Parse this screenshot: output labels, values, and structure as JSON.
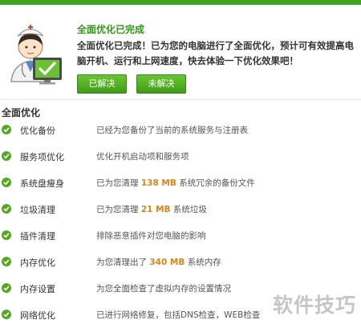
{
  "header": {
    "title": "全面优化已完成",
    "description": "全面优化已完成！已为您的电脑进行了全面优化，预计可有效提高电脑开机、运行和上网速度，快去体验一下优化效果吧！",
    "resolved_label": "已解决",
    "unresolved_label": "未解决"
  },
  "section": {
    "title": "全面优化"
  },
  "items": [
    {
      "name": "优化备份",
      "text": "已经为您备份了当前的系统服务与注册表"
    },
    {
      "name": "服务项优化",
      "text": "优化开机启动项和服务项"
    },
    {
      "name": "系统盘瘦身",
      "text_before": "已为您清理",
      "value": "138 MB",
      "text_after": "系统冗余的备份文件"
    },
    {
      "name": "垃圾清理",
      "text_before": "已为您清理",
      "value": "21 MB",
      "text_after": "系统垃圾"
    },
    {
      "name": "插件清理",
      "text": "排除恶意插件对您电脑的影响"
    },
    {
      "name": "内存优化",
      "text_before": "为您清理出了",
      "value": "340 MB",
      "text_after": "系统内存"
    },
    {
      "name": "内存设置",
      "text": "为您全面检查了虚拟内存的设置情况"
    },
    {
      "name": "网络优化",
      "text": "已进行网络修复，包括DNS检查，WEB检查"
    }
  ],
  "watermark": "软件技巧",
  "colors": {
    "brand_green": "#3fa31b",
    "highlight_orange": "#e08316",
    "check_green": "#54a81f"
  }
}
